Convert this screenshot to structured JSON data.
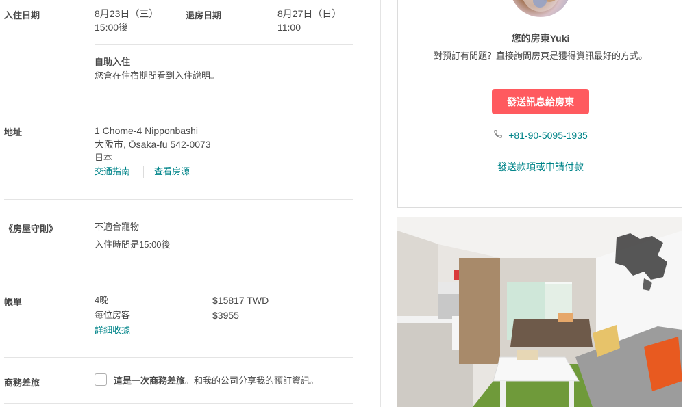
{
  "checkin": {
    "checkin_label": "入住日期",
    "checkin_date": "8月23日（三）",
    "checkin_time": "15:00後",
    "checkout_label": "退房日期",
    "checkout_date": "8月27日（日）",
    "checkout_time": "11:00",
    "self_checkin_title": "自助入住",
    "self_checkin_desc": "您會在住宿期間看到入住說明。"
  },
  "address": {
    "label": "地址",
    "line1": "1 Chome-4 Nipponbashi",
    "line2": "大阪市, Ōsaka-fu 542-0073",
    "line3": "日本",
    "directions_link": "交通指南",
    "view_listing_link": "查看房源"
  },
  "house_rules": {
    "label": "《房屋守則》",
    "rule1": "不適合寵物",
    "rule2": "入住時間是15:00後"
  },
  "bill": {
    "label": "帳單",
    "nights_label": "4晚",
    "nights_amount": "$15817 TWD",
    "per_guest_label": "每位房客",
    "per_guest_amount": "$3955",
    "receipt_link": "詳細收據"
  },
  "business": {
    "label": "商務差旅",
    "bold_text": "這是一次商務差旅",
    "rest_text": "。和我的公司分享我的預訂資訊。",
    "checked": false
  },
  "host": {
    "name": "您的房東Yuki",
    "description": "對預訂有問題？直接詢問房東是獲得資訊最好的方式。",
    "message_button": "發送訊息給房東",
    "phone_icon": "phone-icon",
    "phone": "+81-90-5095-1935",
    "payment_link": "發送款項或申請付款"
  },
  "colors": {
    "accent": "#ff5a5f",
    "link": "#008489",
    "text": "#484848"
  }
}
